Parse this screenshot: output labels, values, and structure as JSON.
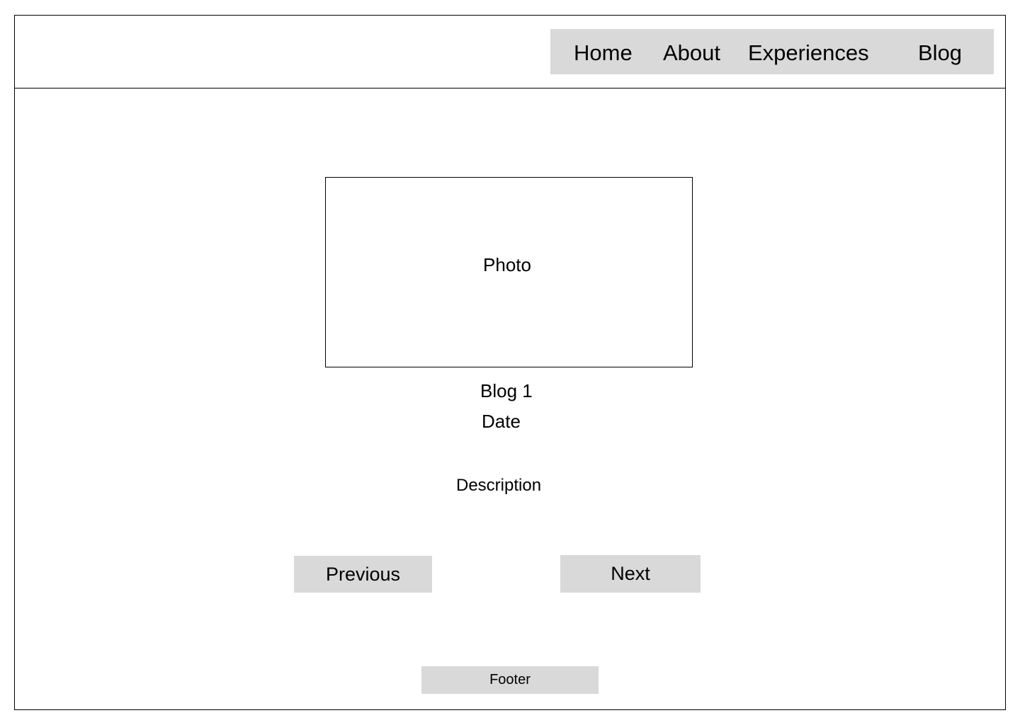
{
  "nav": {
    "items": [
      {
        "label": "Home"
      },
      {
        "label": "About"
      },
      {
        "label": "Experiences"
      },
      {
        "label": "Blog"
      }
    ],
    "background": "#d9d9d9"
  },
  "main": {
    "photo_label": "Photo",
    "blog_title": "Blog 1",
    "date": "Date",
    "description": "Description"
  },
  "pagination": {
    "previous_label": "Previous",
    "next_label": "Next"
  },
  "footer": {
    "label": "Footer"
  }
}
